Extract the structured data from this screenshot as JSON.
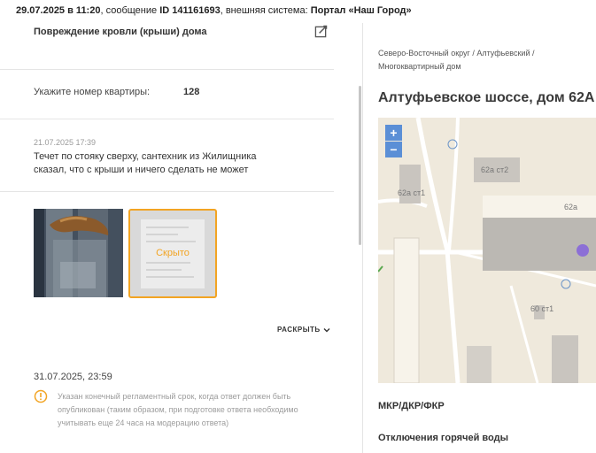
{
  "header": {
    "date_time": "29.07.2025 в 11:20",
    "message_prefix": ", сообщение ",
    "message_id": "ID 141161693",
    "system_prefix": ", внешняя система: ",
    "system_name": "Портал «Наш Город»"
  },
  "problem": {
    "title": "Повреждение кровли (крыши) дома",
    "edit_icon": "edit-icon"
  },
  "apartment": {
    "label": "Укажите номер квартиры:",
    "value": "128"
  },
  "comment": {
    "date": "21.07.2025 17:39",
    "text": "Течет по стояку сверху, сантехник из Жилищника сказал, что с крыши и ничего сделать не может"
  },
  "attachments": {
    "hidden_label": "Скрыто",
    "accent": "#f2a423"
  },
  "expand": {
    "label": "РАСКРЫТЬ",
    "icon": "chevron-down-icon"
  },
  "deadline": {
    "date": "31.07.2025, 23:59",
    "icon": "info-icon",
    "notice": "Указан конечный регламентный срок, когда ответ должен быть опубликован (таким образом, при подготовке ответа необходимо учитывать еще 24 часа на модерацию ответа)"
  },
  "object": {
    "breadcrumb": "Северо-Восточный округ / Алтуфьевский / Многоквартирный дом",
    "address": "Алтуфьевское шоссе, дом 62А"
  },
  "map": {
    "zoom_in": "+",
    "zoom_out": "−",
    "labels": {
      "b1": "62а ст1",
      "b2": "62а ст2",
      "b3": "62а",
      "b4": "60 ст1"
    },
    "marker_color": "#8c6fd6",
    "zoom_color": "#5b8fd6"
  },
  "sections": {
    "first": "МКР/ДКР/ФКР",
    "second": "Отключения горячей воды"
  }
}
